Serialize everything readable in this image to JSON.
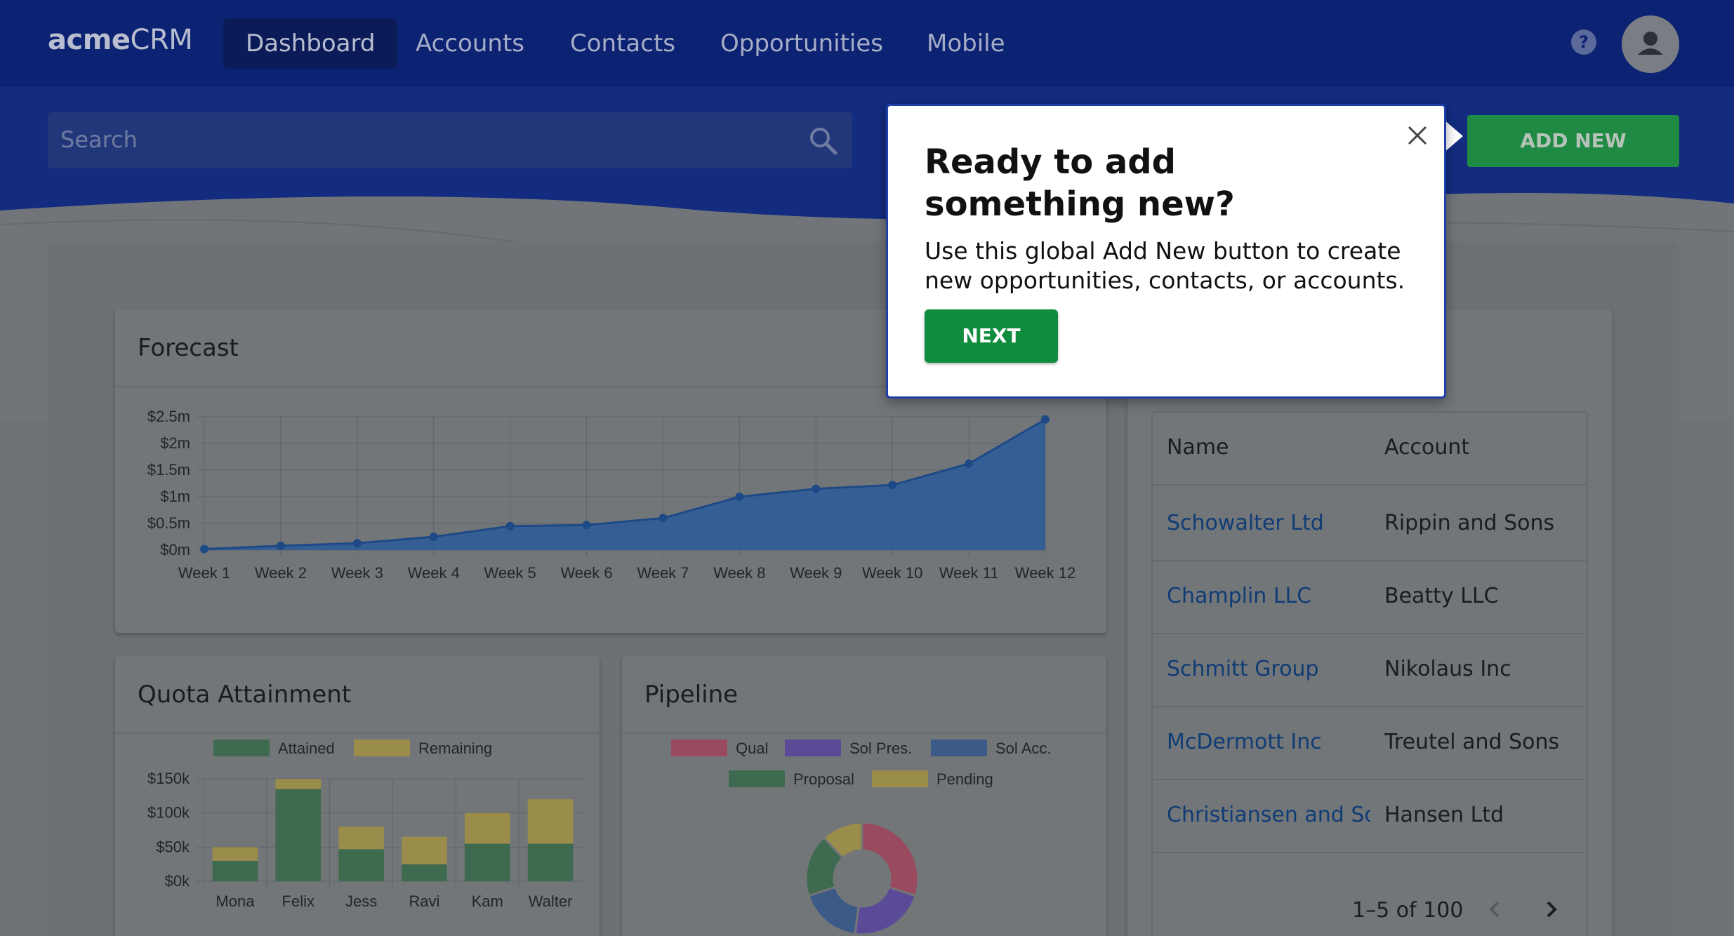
{
  "app": {
    "logo_bold": "acme",
    "logo_regular": "CRM"
  },
  "nav": [
    {
      "label": "Dashboard",
      "active": true
    },
    {
      "label": "Accounts",
      "active": false
    },
    {
      "label": "Contacts",
      "active": false
    },
    {
      "label": "Opportunities",
      "active": false
    },
    {
      "label": "Mobile",
      "active": false
    }
  ],
  "header": {
    "help_icon": "help-circle-icon",
    "avatar_icon": "user-avatar-icon"
  },
  "search": {
    "placeholder": "Search",
    "icon": "search-icon"
  },
  "add_new": {
    "label": "ADD NEW",
    "color": "#1f8a43"
  },
  "popover": {
    "title": "Ready to add something new?",
    "body": "Use this global Add New button to create new opportunities, contacts, or accounts.",
    "next_label": "NEXT",
    "close_icon": "close-icon",
    "border_color": "#1f3ea8"
  },
  "cards": {
    "forecast_title": "Forecast",
    "quota_title": "Quota Attainment",
    "pipeline_title": "Pipeline"
  },
  "chart_data": [
    {
      "type": "area",
      "title": "Forecast",
      "categories": [
        "Week 1",
        "Week 2",
        "Week 3",
        "Week 4",
        "Week 5",
        "Week 6",
        "Week 7",
        "Week 8",
        "Week 9",
        "Week 10",
        "Week 11",
        "Week 12"
      ],
      "values": [
        0.02,
        0.08,
        0.13,
        0.25,
        0.45,
        0.47,
        0.6,
        1.0,
        1.15,
        1.22,
        1.62,
        2.45
      ],
      "yticks": [
        "$0m",
        "$0.5m",
        "$1m",
        "$1.5m",
        "$2m",
        "$2.5m"
      ],
      "ylim": [
        0,
        2.5
      ],
      "grid": true,
      "color": "#2a5a9a"
    },
    {
      "type": "bar",
      "title": "Quota Attainment",
      "stacked": true,
      "categories": [
        "Mona",
        "Felix",
        "Jess",
        "Ravi",
        "Kam",
        "Walter"
      ],
      "series": [
        {
          "name": "Attained",
          "values": [
            30,
            135,
            47,
            25,
            55,
            55
          ],
          "color": "#3e6b4f"
        },
        {
          "name": "Remaining",
          "values": [
            20,
            15,
            33,
            40,
            45,
            65
          ],
          "color": "#9a8c4a"
        }
      ],
      "yticks": [
        "$0k",
        "$50k",
        "$100k",
        "$150k"
      ],
      "ylim": [
        0,
        150
      ],
      "legend": "top"
    },
    {
      "type": "pie",
      "title": "Pipeline",
      "donut": true,
      "labels": [
        "Qual",
        "Sol Pres.",
        "Sol Acc.",
        "Proposal",
        "Pending"
      ],
      "values": [
        30,
        22,
        18,
        18,
        12
      ],
      "colors": [
        "#9a4a5e",
        "#5a4a98",
        "#3b5a88",
        "#3e6b4f",
        "#9a8c4a"
      ],
      "legend": "top"
    }
  ],
  "table": {
    "headers": [
      "Name",
      "Account"
    ],
    "rows": [
      {
        "name": "Schowalter Ltd",
        "account": "Rippin and Sons"
      },
      {
        "name": "Champlin LLC",
        "account": "Beatty LLC"
      },
      {
        "name": "Schmitt Group",
        "account": "Nikolaus Inc"
      },
      {
        "name": "McDermott Inc",
        "account": "Treutel and Sons"
      },
      {
        "name": "Christiansen and Sons",
        "account": "Hansen Ltd"
      }
    ],
    "pagination": "1–5 of 100",
    "prev_icon": "chevron-left-icon",
    "next_icon": "chevron-right-icon"
  }
}
